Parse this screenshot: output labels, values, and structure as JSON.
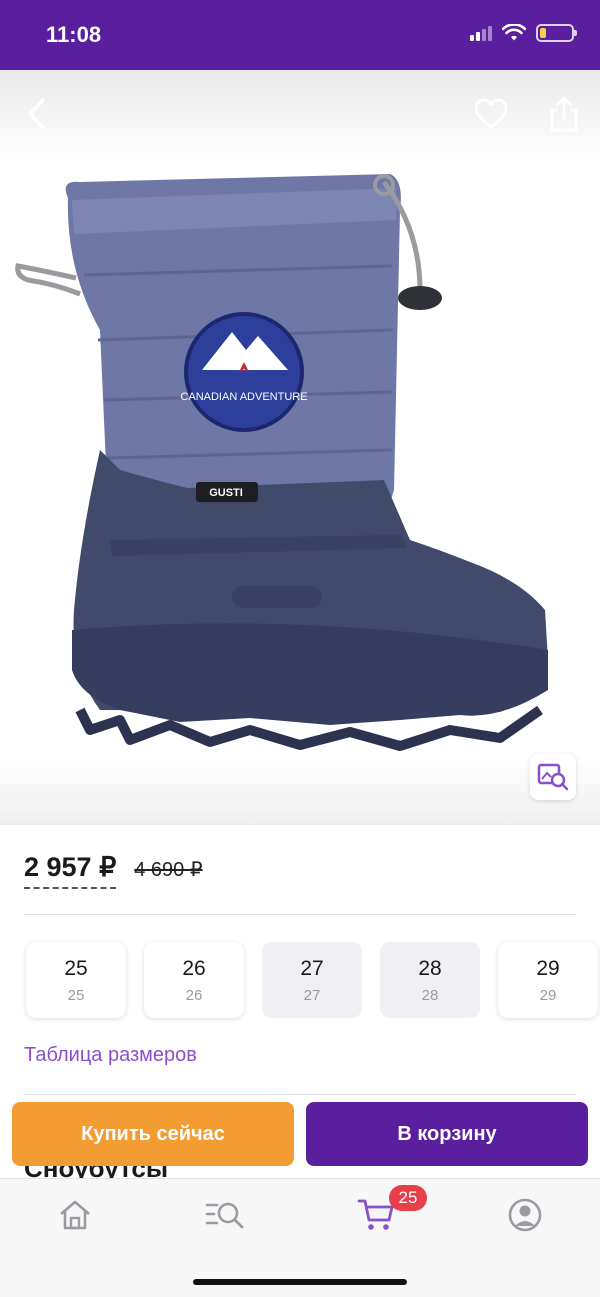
{
  "status_bar": {
    "time": "11:08",
    "battery_level": 0.2
  },
  "header": {
    "back_icon": "chevron-left-icon",
    "favorite_icon": "heart-icon",
    "share_icon": "share-icon",
    "zoom_icon": "image-search-icon"
  },
  "product": {
    "image": {
      "patch_text": "CANADIAN ADVENTURE",
      "brand_tag": "GUSTI"
    },
    "price_current": "2 957 ₽",
    "price_old": "4 690 ₽",
    "sizes": [
      {
        "size": "25",
        "sub": "25",
        "available": true
      },
      {
        "size": "26",
        "sub": "26",
        "available": true
      },
      {
        "size": "27",
        "sub": "27",
        "available": false
      },
      {
        "size": "28",
        "sub": "28",
        "available": false
      },
      {
        "size": "29",
        "sub": "29",
        "available": true
      }
    ],
    "size_table_link": "Таблица размеров",
    "title_peek": "Сноубутсы"
  },
  "actions": {
    "buy_now": "Купить сейчас",
    "add_to_cart": "В корзину"
  },
  "tab_bar": {
    "items": [
      {
        "icon": "home-icon"
      },
      {
        "icon": "catalog-search-icon"
      },
      {
        "icon": "cart-icon",
        "active": true
      },
      {
        "icon": "profile-icon"
      }
    ],
    "cart_badge": "25"
  },
  "colors": {
    "brand_purple": "#5a1f9e",
    "accent_orange": "#f39c34",
    "link_purple": "#8b4fc9",
    "badge_red": "#e8404a"
  }
}
